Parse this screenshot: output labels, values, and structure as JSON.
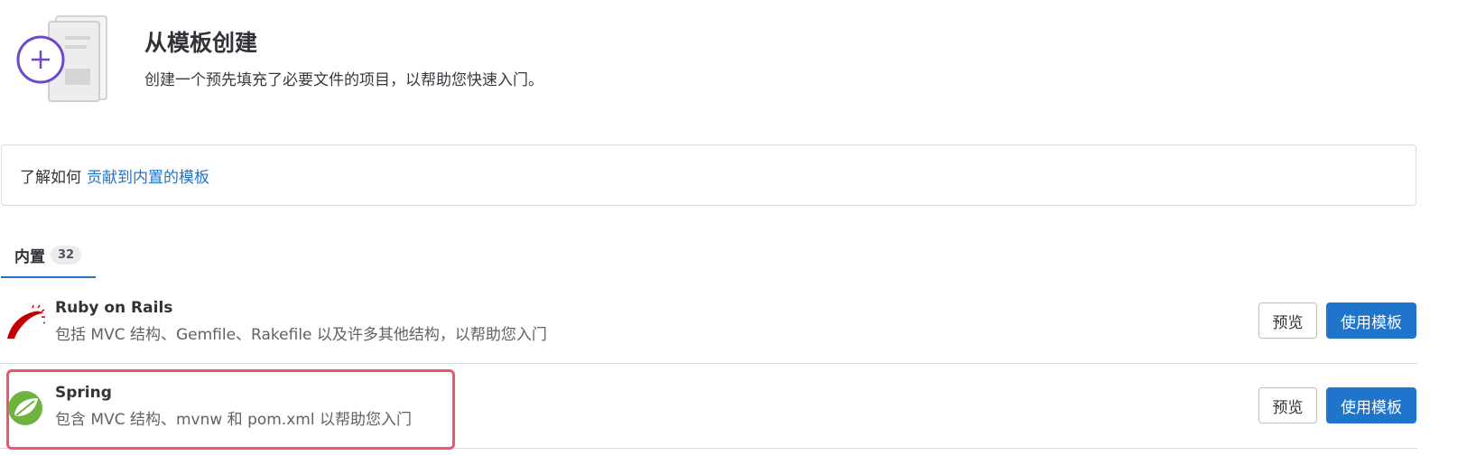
{
  "header": {
    "title": "从模板创建",
    "description": "创建一个预先填充了必要文件的项目，以帮助您快速入门。"
  },
  "info": {
    "prefix": "了解如何",
    "link": "贡献到内置的模板"
  },
  "tabs": [
    {
      "label": "内置",
      "count": "32"
    }
  ],
  "templates": [
    {
      "name": "Ruby on Rails",
      "description": "包括 MVC 结构、Gemfile、Rakefile 以及许多其他结构，以帮助您入门",
      "preview_label": "预览",
      "use_label": "使用模板",
      "icon": "ruby-on-rails-logo-icon"
    },
    {
      "name": "Spring",
      "description": "包含 MVC 结构、mvnw 和 pom.xml 以帮助您入门",
      "preview_label": "预览",
      "use_label": "使用模板",
      "icon": "spring-logo-icon"
    }
  ],
  "colors": {
    "accent": "#1f75cb",
    "highlight": "#f0566a",
    "purple": "#6e49cb"
  }
}
